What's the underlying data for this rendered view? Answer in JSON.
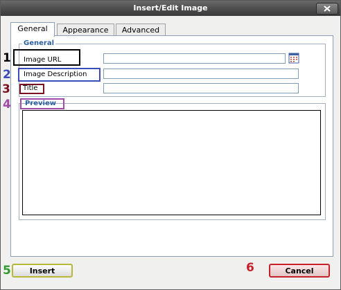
{
  "dialog": {
    "title": "Insert/Edit Image",
    "close_icon": "close-icon"
  },
  "tabs": [
    {
      "label": "General",
      "active": true
    },
    {
      "label": "Appearance",
      "active": false
    },
    {
      "label": "Advanced",
      "active": false
    }
  ],
  "general": {
    "legend": "General",
    "image_url_label": "Image URL",
    "image_url_value": "",
    "browse_icon": "browse-icon",
    "image_description_label": "Image Description",
    "image_description_value": "",
    "title_label": "Title",
    "title_value": ""
  },
  "preview": {
    "legend": "Preview"
  },
  "buttons": {
    "insert": "Insert",
    "cancel": "Cancel"
  },
  "annotations": {
    "numbers": [
      "1",
      "2",
      "3",
      "4",
      "5",
      "6"
    ],
    "colors": {
      "1": "#000000",
      "2": "#3b4bb8",
      "3": "#7a1020",
      "4": "#a24aa8",
      "5": "#2e9b2e",
      "6": "#c8202a"
    }
  }
}
